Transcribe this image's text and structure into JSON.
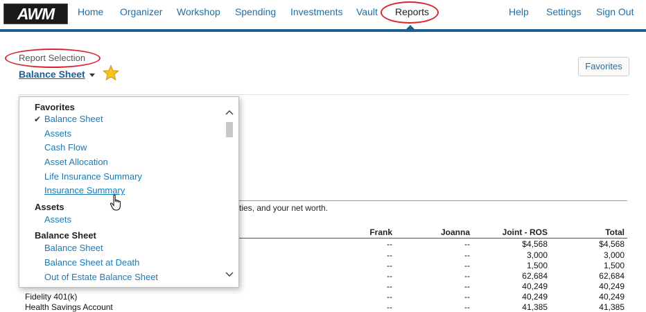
{
  "nav": {
    "logo": "AWM",
    "items": [
      "Home",
      "Organizer",
      "Workshop",
      "Spending",
      "Investments",
      "Vault",
      "Reports"
    ],
    "right_items": [
      "Help",
      "Settings",
      "Sign Out"
    ],
    "active": "Reports"
  },
  "report": {
    "selection_label": "Report Selection",
    "title": "Balance Sheet",
    "favorites_button": "Favorites",
    "description": "ties, and your net worth."
  },
  "dropdown": {
    "groups": [
      {
        "label": "Favorites",
        "items": [
          "Balance Sheet",
          "Assets",
          "Cash Flow",
          "Asset Allocation",
          "Life Insurance Summary",
          "Insurance Summary"
        ]
      },
      {
        "label": "Assets",
        "items": [
          "Assets"
        ]
      },
      {
        "label": "Balance Sheet",
        "items": [
          "Balance Sheet",
          "Balance Sheet at Death",
          "Out of Estate Balance Sheet"
        ]
      }
    ],
    "checked": "Balance Sheet",
    "hovered": "Insurance Summary"
  },
  "table": {
    "columns": [
      "Frank",
      "Joanna",
      "Joint - ROS",
      "Total"
    ],
    "rows": [
      {
        "label": "",
        "values": [
          "--",
          "--",
          "$4,568",
          "$4,568"
        ]
      },
      {
        "label": "",
        "values": [
          "--",
          "--",
          "3,000",
          "3,000"
        ]
      },
      {
        "label": "",
        "values": [
          "--",
          "--",
          "1,500",
          "1,500"
        ]
      },
      {
        "label": "",
        "values": [
          "--",
          "--",
          "62,684",
          "62,684"
        ]
      },
      {
        "label": "",
        "values": [
          "--",
          "--",
          "40,249",
          "40,249"
        ]
      },
      {
        "label": "Fidelity 401(k)",
        "values": [
          "--",
          "--",
          "40,249",
          "40,249"
        ]
      },
      {
        "label": "Health Savings Account",
        "values": [
          "--",
          "--",
          "41,385",
          "41,385"
        ]
      }
    ]
  },
  "colors": {
    "nav_link": "#1a6fa8",
    "nav_bar": "#1f5f8b",
    "annotation": "#d8262b",
    "star": "#f5c518"
  },
  "icons": [
    "star-icon",
    "checkmark-icon",
    "chevron-up-icon",
    "chevron-down-icon",
    "hand-cursor-icon",
    "caret-down-icon"
  ]
}
